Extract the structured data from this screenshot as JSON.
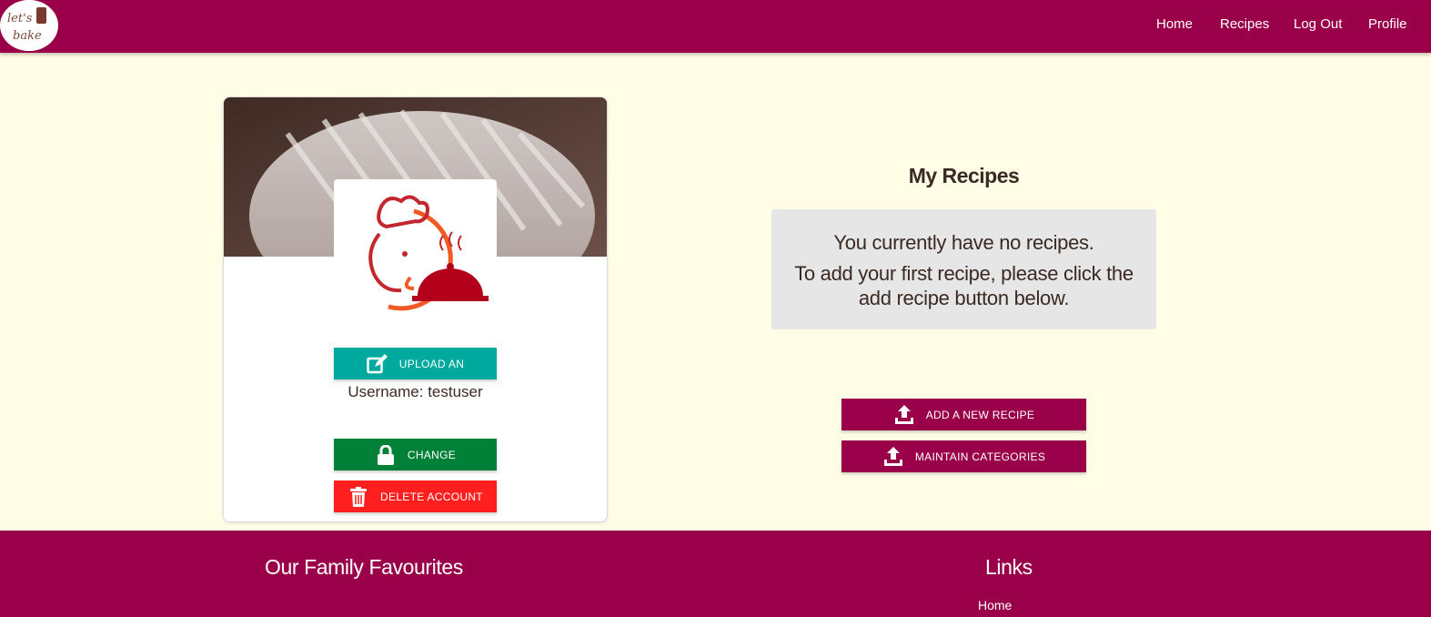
{
  "brand": {
    "logo_text": "let's bake"
  },
  "nav": {
    "items": [
      {
        "label": "Home"
      },
      {
        "label": "Recipes"
      },
      {
        "label": "Log Out"
      },
      {
        "label": "Profile"
      }
    ]
  },
  "profile": {
    "upload_label": "UPLOAD AN",
    "username_text": "Username: testuser",
    "change_label": "CHANGE",
    "delete_label": "DELETE ACCOUNT"
  },
  "recipes": {
    "title": "My Recipes",
    "empty_line1": "You currently have no recipes.",
    "empty_line2": "To add your first recipe, please click the add recipe button below.",
    "add_label": "ADD A NEW RECIPE",
    "maintain_label": "MAINTAIN CATEGORIES"
  },
  "footer": {
    "left_title": "Our Family Favourites",
    "right_title": "Links",
    "links": [
      {
        "label": "Home"
      }
    ]
  },
  "colors": {
    "brand": "#9a0049",
    "teal": "#00a99d",
    "green": "#008137",
    "red": "#ff1f1f",
    "background": "#fffde6"
  }
}
